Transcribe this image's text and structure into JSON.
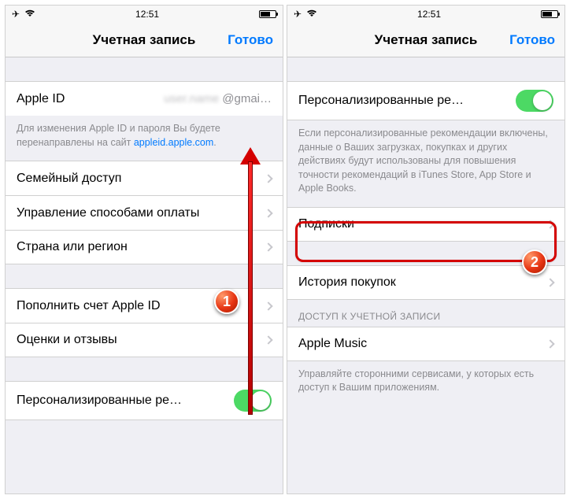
{
  "statusbar": {
    "time": "12:51"
  },
  "nav": {
    "title": "Учетная запись",
    "done": "Готово"
  },
  "left": {
    "apple_id_label": "Apple ID",
    "apple_id_value": "@gmai…",
    "footer1_a": "Для изменения Apple ID и пароля Вы будете перенаправлены на сайт ",
    "footer1_link": "appleid.apple.com",
    "rows": {
      "family": "Семейный доступ",
      "payment": "Управление способами оплаты",
      "country": "Страна или регион",
      "topup": "Пополнить счет Apple ID",
      "reviews": "Оценки и отзывы",
      "personal": "Персонализированные ре…"
    }
  },
  "right": {
    "personal": "Персонализированные ре…",
    "personal_footer": "Если персонализированные рекомендации включены, данные о Ваших загрузках, покупках и других действиях будут использованы для повышения точности рекомендаций в iTunes Store, App Store и Apple Books.",
    "subs": "Подписки",
    "history": "История покупок",
    "access_header": "ДОСТУП К УЧЕТНОЙ ЗАПИСИ",
    "apple_music": "Apple Music",
    "access_footer": "Управляйте сторонними сервисами, у которых есть доступ к Вашим приложениям."
  },
  "badges": {
    "one": "1",
    "two": "2"
  }
}
